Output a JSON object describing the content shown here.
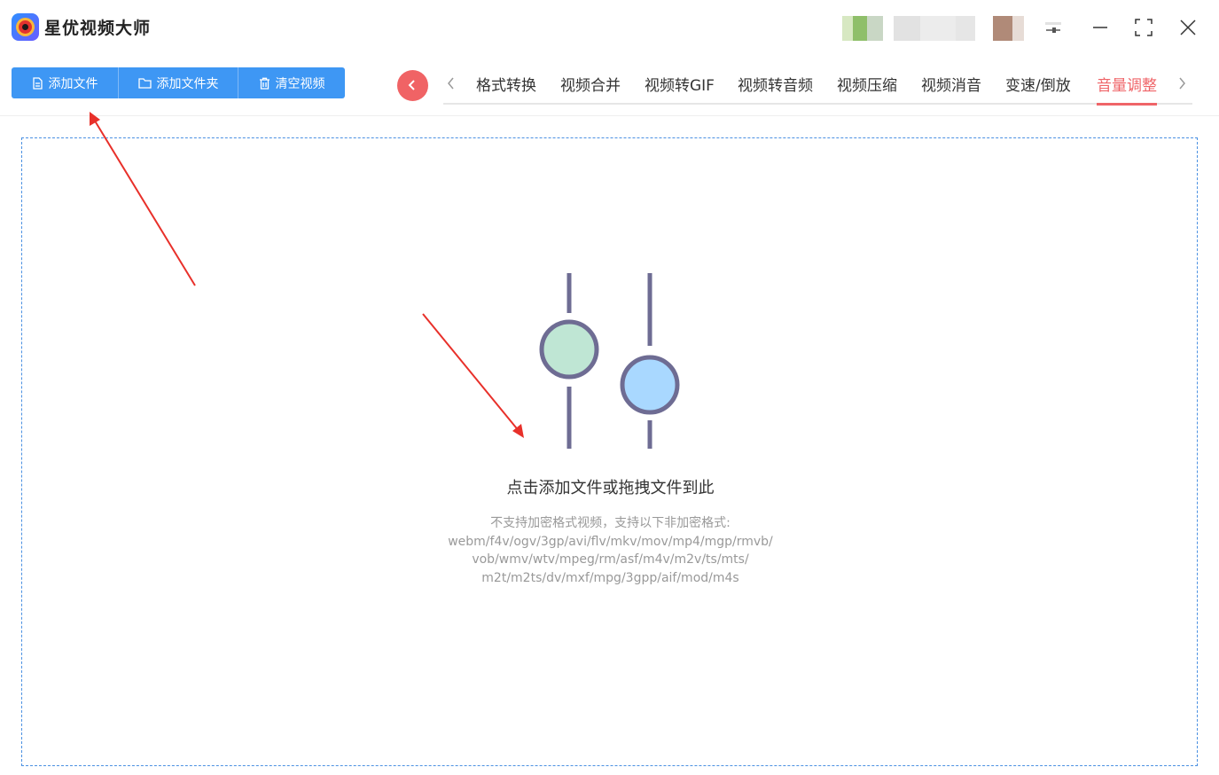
{
  "app": {
    "title": "星优视频大师",
    "logo_icon": "camera-lens-icon"
  },
  "window_controls": {
    "settings_icon": "sliders-icon",
    "minimize_icon": "minimize-icon",
    "maximize_icon": "maximize-icon",
    "close_icon": "close-icon"
  },
  "toolbar": {
    "add_file_label": "添加文件",
    "add_folder_label": "添加文件夹",
    "clear_label": "清空视频"
  },
  "tabs": {
    "items": [
      {
        "label": "格式转换",
        "active": false
      },
      {
        "label": "视频合并",
        "active": false
      },
      {
        "label": "视频转GIF",
        "active": false
      },
      {
        "label": "视频转音频",
        "active": false
      },
      {
        "label": "视频压缩",
        "active": false
      },
      {
        "label": "视频消音",
        "active": false
      },
      {
        "label": "变速/倒放",
        "active": false
      },
      {
        "label": "音量调整",
        "active": true
      }
    ],
    "active_color": "#ef6468"
  },
  "dropzone": {
    "main_text": "点击添加文件或拖拽文件到此",
    "sub_lines": [
      "不支持加密格式视频，支持以下非加密格式:",
      "webm/f4v/ogv/3gp/avi/flv/mkv/mov/mp4/mgp/rmvb/",
      "vob/wmv/wtv/mpeg/rm/asf/m4v/m2v/ts/mts/",
      "m2t/m2ts/dv/mxf/mpg/3gpp/aif/mod/m4s"
    ],
    "illustration_icon": "volume-sliders-icon"
  },
  "colors": {
    "accent_blue": "#3e97f4",
    "accent_red": "#ef6468",
    "slider_green": "#bfe6d4",
    "slider_blue": "#a9d8ff",
    "slider_stroke": "#6e6c93",
    "annotation_arrow": "#e8302a"
  }
}
